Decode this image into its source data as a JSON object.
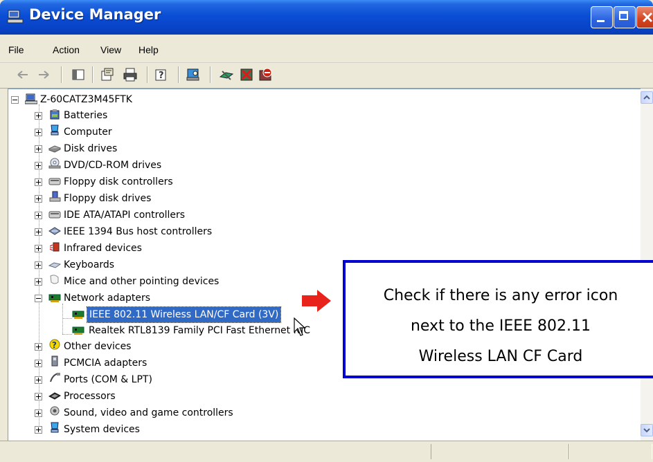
{
  "window": {
    "title": "Device Manager"
  },
  "menu": [
    "File",
    "Action",
    "View",
    "Help"
  ],
  "toolbar": {
    "icons": [
      "back-icon",
      "forward-icon",
      "show-hide-tree-icon",
      "properties-icon",
      "print-icon",
      "help-icon",
      "scan-hardware-icon",
      "update-driver-icon",
      "uninstall-icon",
      "disable-icon"
    ]
  },
  "tree": {
    "root": "Z-60CATZ3M45FTK",
    "categories": [
      "Batteries",
      "Computer",
      "Disk drives",
      "DVD/CD-ROM drives",
      "Floppy disk controllers",
      "Floppy disk drives",
      "IDE ATA/ATAPI controllers",
      "IEEE 1394 Bus host controllers",
      "Infrared devices",
      "Keyboards",
      "Mice and other pointing devices",
      "Network adapters",
      "Other devices",
      "PCMCIA adapters",
      "Ports (COM & LPT)",
      "Processors",
      "Sound, video and game controllers",
      "System devices"
    ],
    "network_children": [
      "IEEE 802.11 Wireless LAN/CF Card (3V)",
      "Realtek RTL8139 Family PCI Fast Ethernet NIC"
    ]
  },
  "callout": {
    "text": "Check if there is any error icon\nnext to the IEEE 802.11\nWireless LAN CF Card"
  },
  "colors": {
    "selection": "#316ac5",
    "callout_border": "#0000d0",
    "arrow": "#e8231b",
    "titlebar": "#0a4ed6"
  }
}
